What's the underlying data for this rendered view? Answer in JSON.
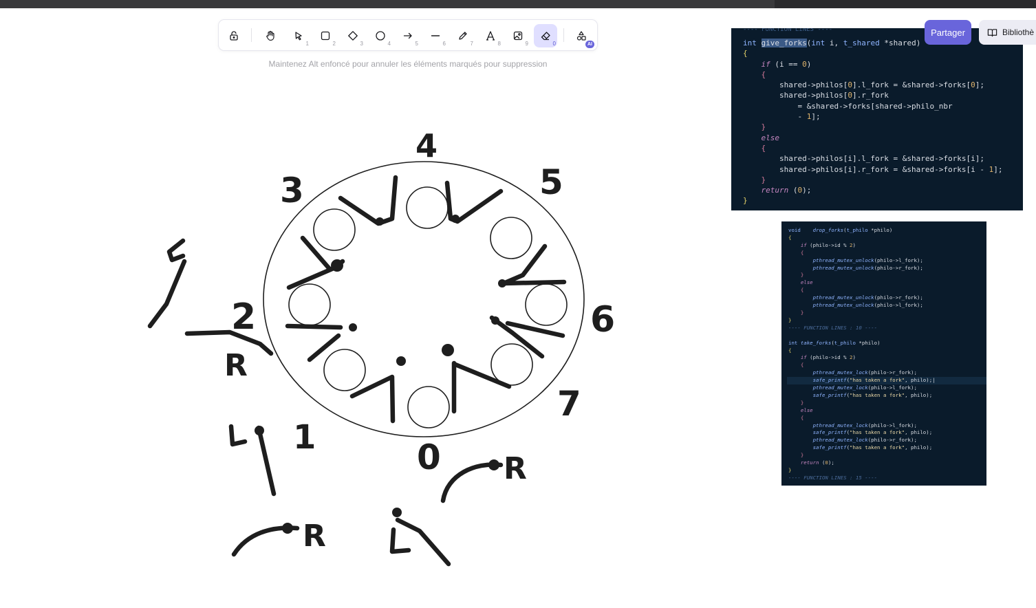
{
  "toolbar": {
    "tools": [
      {
        "name": "lock",
        "shortcut": ""
      },
      {
        "name": "hand",
        "shortcut": ""
      },
      {
        "name": "select",
        "shortcut": "1"
      },
      {
        "name": "rectangle",
        "shortcut": "2"
      },
      {
        "name": "diamond",
        "shortcut": "3"
      },
      {
        "name": "ellipse",
        "shortcut": "4"
      },
      {
        "name": "arrow",
        "shortcut": "5"
      },
      {
        "name": "line",
        "shortcut": "6"
      },
      {
        "name": "draw",
        "shortcut": "7"
      },
      {
        "name": "text",
        "shortcut": "8"
      },
      {
        "name": "image",
        "shortcut": "9"
      },
      {
        "name": "eraser",
        "shortcut": "0"
      }
    ],
    "ai_badge": "AI",
    "active_tool": "eraser",
    "accent_color": "#6965db"
  },
  "hint": "Maintenez Alt enfoncé pour annuler les éléments marqués pour suppression",
  "header": {
    "share_label": "Partager",
    "library_label": "Bibliothè"
  },
  "drawing": {
    "numbers": [
      "0",
      "1",
      "2",
      "3",
      "4",
      "5",
      "6",
      "7"
    ],
    "letters": [
      "R",
      "R",
      "R"
    ]
  },
  "code_snippet_1": {
    "lines": [
      "int give_forks(int i, t_shared *shared)",
      "{",
      "    if (i == 0)",
      "    {",
      "        shared->philos[0].l_fork = &shared->forks[0];",
      "        shared->philos[0].r_fork",
      "            = &shared->forks[shared->philo_nbr",
      "            - 1];",
      "    }",
      "    else",
      "    {",
      "        shared->philos[i].l_fork = &shared->forks[i];",
      "        shared->philos[i].r_fork = &shared->forks[i - 1];",
      "    }",
      "    return (0);",
      "}"
    ]
  },
  "code_snippet_2": {
    "lines": [
      "void    drop_forks(t_philo *philo)",
      "{",
      "    if (philo->id % 2)",
      "    {",
      "        pthread_mutex_unlock(philo->l_fork);",
      "        pthread_mutex_unlock(philo->r_fork);",
      "    }",
      "    else",
      "    {",
      "        pthread_mutex_unlock(philo->r_fork);",
      "        pthread_mutex_unlock(philo->l_fork);",
      "    }",
      "}",
      "---- FUNCTION LINES : 10 ----",
      "",
      "int take_forks(t_philo *philo)",
      "{",
      "    if (philo->id % 2)",
      "    {",
      "        pthread_mutex_lock(philo->r_fork);",
      "        safe_printf(\"has taken a fork\", philo);",
      "        pthread_mutex_lock(philo->l_fork);",
      "        safe_printf(\"has taken a fork\", philo);",
      "    }",
      "    else",
      "    {",
      "        pthread_mutex_lock(philo->l_fork);",
      "        safe_printf(\"has taken a fork\", philo);",
      "        pthread_mutex_lock(philo->r_fork);",
      "        safe_printf(\"has taken a fork\", philo);",
      "    }",
      "    return (0);",
      "}",
      "---- FUNCTION LINES : 15 ----"
    ]
  }
}
